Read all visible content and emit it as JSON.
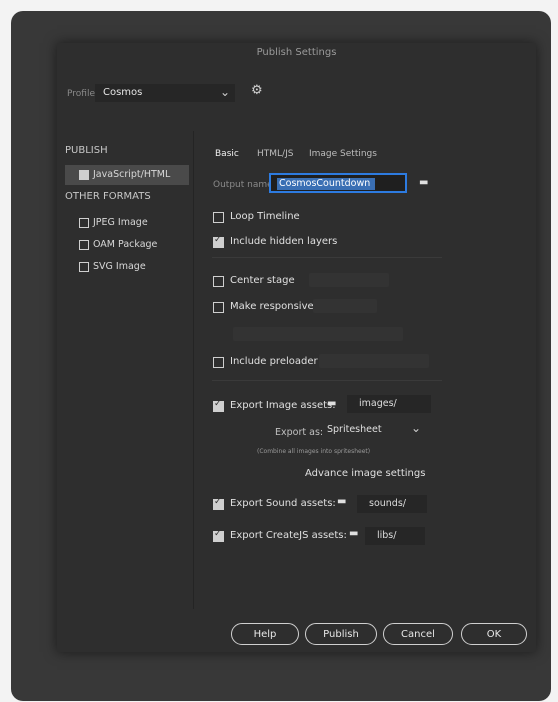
{
  "dialog": {
    "title": "Publish Settings"
  },
  "profile": {
    "label": "Profile:",
    "value": "Cosmos"
  },
  "left": {
    "publish_header": "PUBLISH",
    "publish_item": {
      "label": "JavaScript/HTML",
      "checked": true
    },
    "other_header": "OTHER FORMATS",
    "formats": [
      {
        "label": "JPEG Image",
        "checked": false
      },
      {
        "label": "OAM Package",
        "checked": false
      },
      {
        "label": "SVG Image",
        "checked": false
      }
    ]
  },
  "tabs": [
    "Basic",
    "HTML/JS",
    "Image Settings"
  ],
  "output": {
    "label": "Output name:",
    "value": "CosmosCountdown"
  },
  "options": {
    "loop_timeline": "Loop Timeline",
    "include_hidden": "Include hidden layers",
    "center_stage": "Center stage",
    "make_responsive": "Make responsive",
    "include_preloader": "Include preloader",
    "export_images": "Export Image assets:",
    "export_sound": "Export Sound assets:",
    "export_createjs": "Export CreateJS assets:"
  },
  "folders": {
    "images": "images/",
    "sounds": "sounds/",
    "libs": "libs/"
  },
  "export_as": {
    "label": "Export as:",
    "value": "Spritesheet"
  },
  "combine_note": "(Combine all images into spritesheet)",
  "advance": "Advance image settings",
  "buttons": {
    "help": "Help",
    "publish": "Publish",
    "cancel": "Cancel",
    "ok": "OK"
  },
  "colors": {
    "accent": "#2d7be0",
    "panel": "#2e2e2e"
  }
}
